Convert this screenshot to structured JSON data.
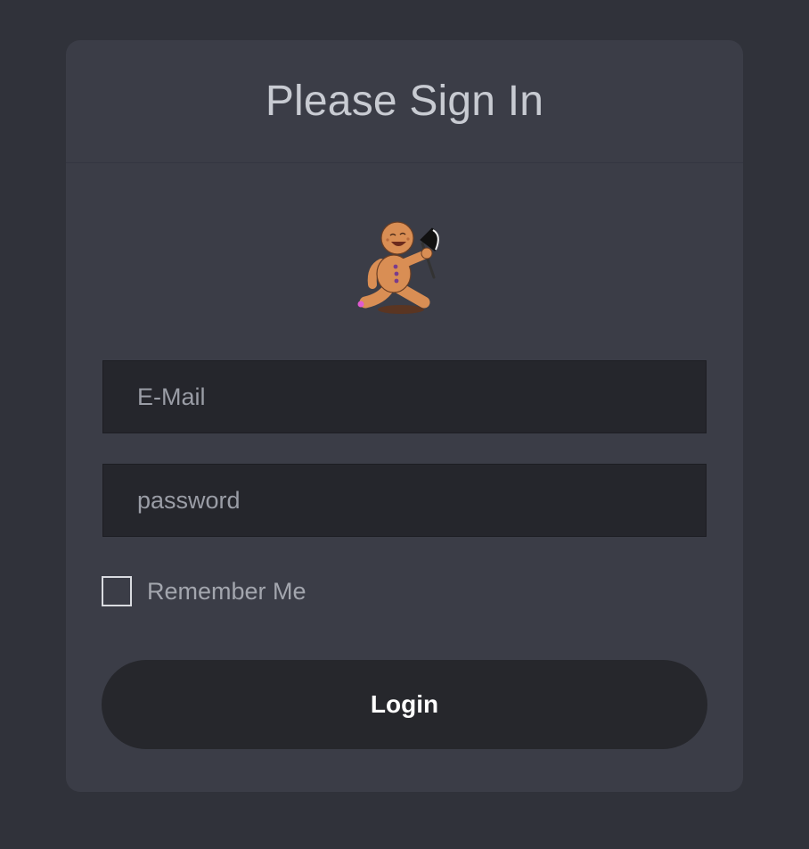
{
  "form": {
    "title": "Please Sign In",
    "logo_icon": "gingerbread-man-with-axe-logo",
    "email": {
      "value": "",
      "placeholder": "E-Mail"
    },
    "password": {
      "value": "",
      "placeholder": "password"
    },
    "remember": {
      "label": "Remember Me",
      "checked": false
    },
    "submit_label": "Login"
  },
  "colors": {
    "page_background": "#30323a",
    "card_background": "#3b3d47",
    "input_background": "#25262c",
    "button_background": "#26272c",
    "button_text": "#ffffff",
    "title_text": "#c8cbd2"
  }
}
